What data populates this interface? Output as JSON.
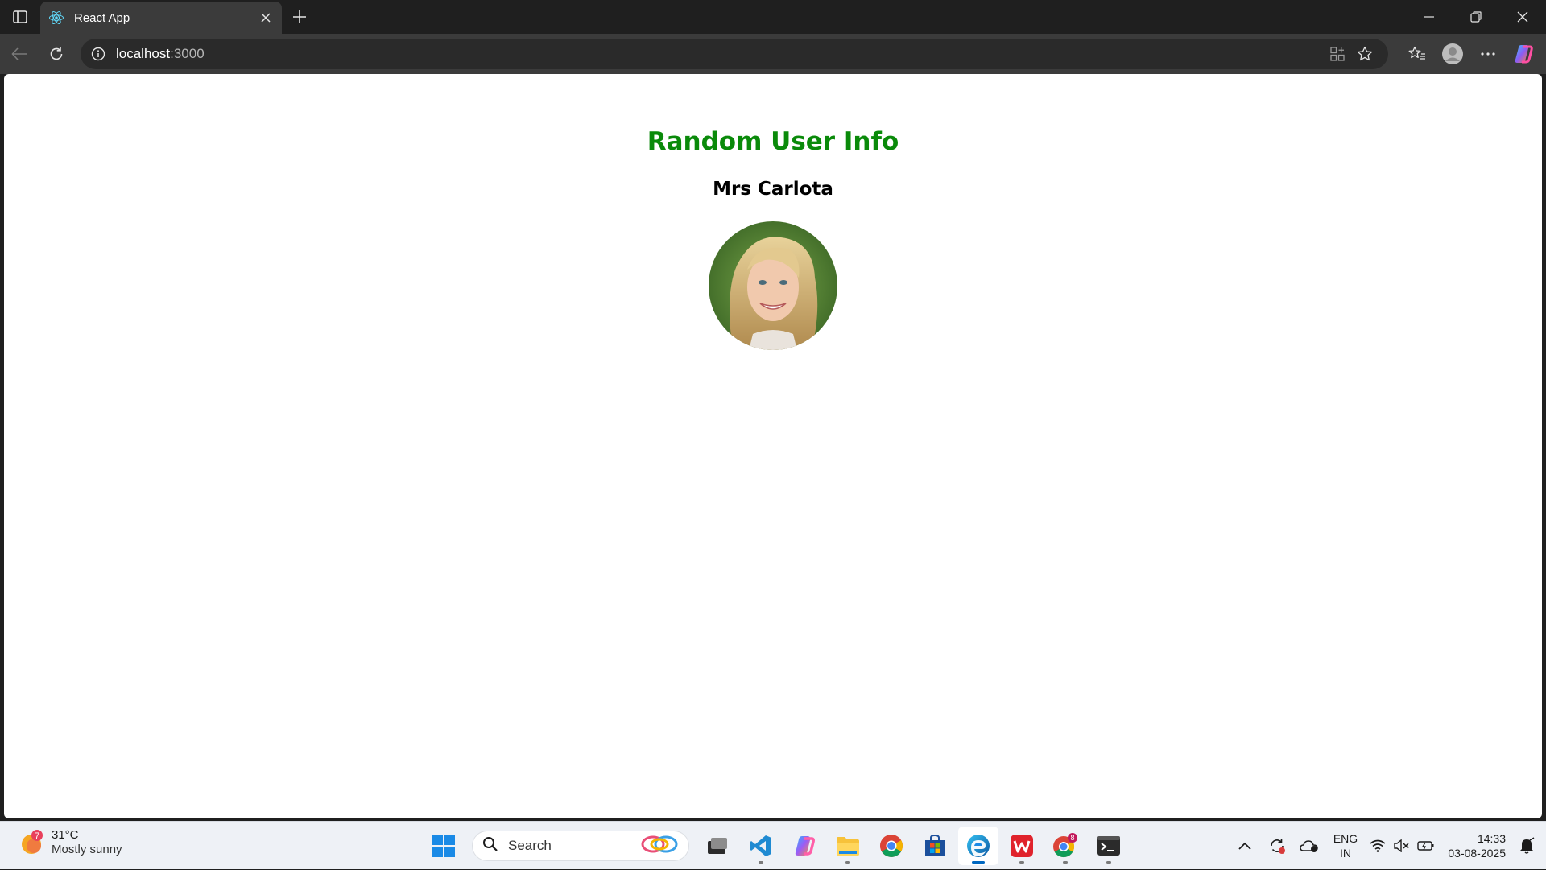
{
  "browser": {
    "tab_title": "React App",
    "url_host": "localhost",
    "url_port": ":3000"
  },
  "page": {
    "heading": "Random User Info",
    "user_name": "Mrs Carlota",
    "avatar_alt": "user photo",
    "heading_color": "#0a8a0a"
  },
  "taskbar": {
    "weather_temp": "31°C",
    "weather_desc": "Mostly sunny",
    "weather_badge": "7",
    "search_label": "Search",
    "chrome_badge": "8",
    "lang_line1": "ENG",
    "lang_line2": "IN",
    "time": "14:33",
    "date": "03-08-2025"
  },
  "icons": {
    "browser": [
      "sidebar-icon",
      "react-favicon",
      "close-icon",
      "plus-icon",
      "minimize-icon",
      "restore-icon",
      "window-close-icon",
      "back-icon",
      "reload-icon",
      "info-icon",
      "apps-icon",
      "star-icon",
      "favorites-icon",
      "profile-icon",
      "more-icon",
      "copilot-icon"
    ],
    "taskbar": [
      "weather-icon",
      "windows-start-icon",
      "search-icon",
      "task-view-icon",
      "vscode-icon",
      "copilot-icon",
      "file-explorer-icon",
      "chrome-icon",
      "store-icon",
      "edge-icon",
      "wps-icon",
      "chrome-profile-icon",
      "terminal-icon",
      "chevron-up-icon",
      "sync-icon",
      "onedrive-icon",
      "wifi-icon",
      "mute-icon",
      "battery-icon",
      "notification-bell-icon"
    ]
  }
}
